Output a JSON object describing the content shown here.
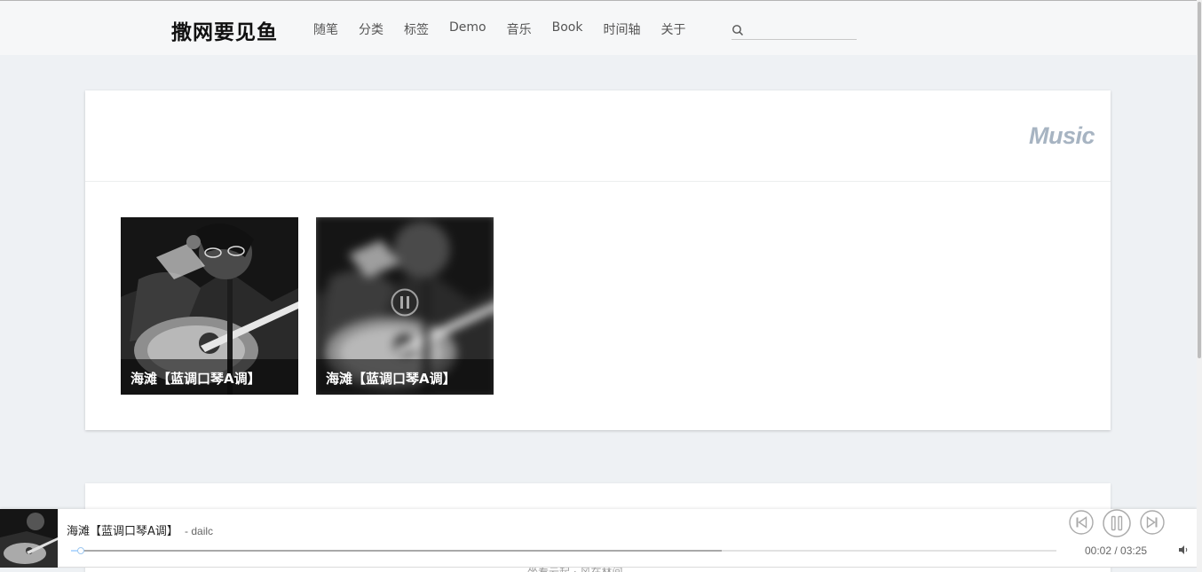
{
  "site": {
    "title": "撒网要见鱼"
  },
  "nav": {
    "items": [
      "随笔",
      "分类",
      "标签",
      "Demo",
      "音乐",
      "Book",
      "时间轴",
      "关于"
    ]
  },
  "search": {
    "value": "",
    "icon": "search-icon"
  },
  "page": {
    "title": "Music"
  },
  "music": {
    "tiles": [
      {
        "caption": "海滩【蓝调口琴A调】",
        "state": "idle"
      },
      {
        "caption": "海滩【蓝调口琴A调】",
        "state": "playing"
      }
    ]
  },
  "player": {
    "title": "海滩【蓝调口琴A调】",
    "author": "- dailc",
    "current_time": "00:02",
    "duration": "03:25",
    "time_display": "00:02 / 03:25",
    "played_fraction": 0.01,
    "loaded_fraction": 0.66,
    "controls": [
      "skip-back-icon",
      "pause-icon",
      "skip-forward-icon",
      "volume-icon"
    ]
  },
  "footer": {
    "partial_text": "坐看云起 · 风在林间"
  },
  "colors": {
    "accent": "#a7b4c2",
    "page_bg": "#eef1f4",
    "progress_played": "#b7daff"
  }
}
